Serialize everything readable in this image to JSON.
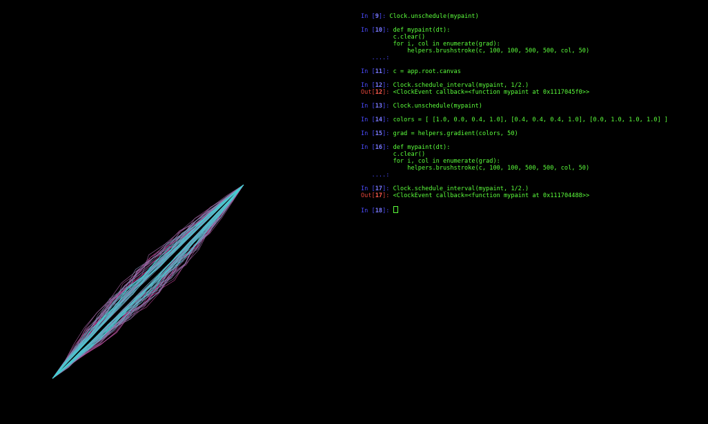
{
  "colors": {
    "background": "#000000",
    "in_prompt": "#4c4cff",
    "out_prompt": "#e0453a",
    "code_text": "#5cff3c",
    "stroke_magenta": "#d02a8a",
    "stroke_cyan": "#3fd6d6"
  },
  "console": {
    "cells": [
      {
        "in_label": "In [",
        "in_num": "9",
        "in_end": "]: ",
        "lines": [
          "Clock.unschedule(mypaint)"
        ]
      },
      {
        "in_label": "In [",
        "in_num": "10",
        "in_end": "]: ",
        "lines": [
          "def mypaint(dt):",
          "    c.clear()",
          "    for i, col in enumerate(grad):",
          "        helpers.brushstroke(c, 100, 100, 500, 500, col, 50)"
        ],
        "cont": "   ....: "
      },
      {
        "in_label": "In [",
        "in_num": "11",
        "in_end": "]: ",
        "lines": [
          "c = app.root.canvas"
        ]
      },
      {
        "in_label": "In [",
        "in_num": "12",
        "in_end": "]: ",
        "lines": [
          "Clock.schedule_interval(mypaint, 1/2.)"
        ],
        "out_label": "Out[",
        "out_num": "12",
        "out_end": "]: ",
        "out_text": "<ClockEvent callback=<function mypaint at 0x1117045f0>>"
      },
      {
        "in_label": "In [",
        "in_num": "13",
        "in_end": "]: ",
        "lines": [
          "Clock.unschedule(mypaint)"
        ]
      },
      {
        "in_label": "In [",
        "in_num": "14",
        "in_end": "]: ",
        "lines": [
          "colors = [ [1.0, 0.0, 0.4, 1.0], [0.4, 0.4, 0.4, 1.0], [0.0, 1.0, 1.0, 1.0] ]"
        ]
      },
      {
        "in_label": "In [",
        "in_num": "15",
        "in_end": "]: ",
        "lines": [
          "grad = helpers.gradient(colors, 50)"
        ]
      },
      {
        "in_label": "In [",
        "in_num": "16",
        "in_end": "]: ",
        "lines": [
          "def mypaint(dt):",
          "    c.clear()",
          "    for i, col in enumerate(grad):",
          "        helpers.brushstroke(c, 100, 100, 500, 500, col, 50)"
        ],
        "cont": "   ....: "
      },
      {
        "in_label": "In [",
        "in_num": "17",
        "in_end": "]: ",
        "lines": [
          "Clock.schedule_interval(mypaint, 1/2.)"
        ],
        "out_label": "Out[",
        "out_num": "17",
        "out_end": "]: ",
        "out_text": "<ClockEvent callback=<function mypaint at 0x111704488>>"
      }
    ],
    "current": {
      "in_label": "In [",
      "in_num": "18",
      "in_end": "]: "
    }
  }
}
